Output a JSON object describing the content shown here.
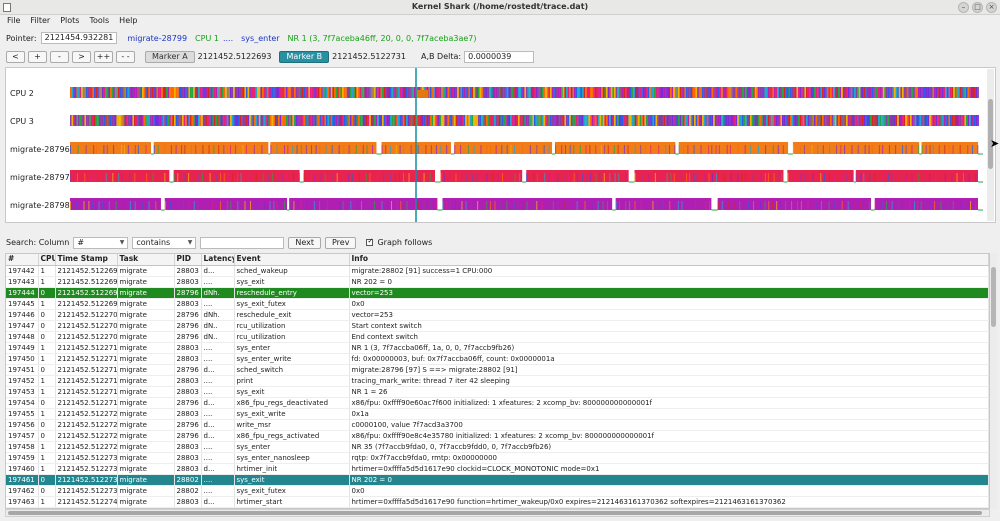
{
  "window": {
    "title": "Kernel Shark (/home/rostedt/trace.dat)"
  },
  "menu": [
    "File",
    "Filter",
    "Plots",
    "Tools",
    "Help"
  ],
  "pointer": {
    "label": "Pointer:",
    "value": "2121454.932281",
    "task": "migrate-28799",
    "cpu": "CPU 1",
    "latency": "....",
    "event": "sys_enter",
    "info": "NR 1 (3, 7f7aceba46ff, 20, 0, 0, 7f7aceba3ae7)"
  },
  "nav": {
    "buttons": [
      "<",
      "+",
      "-",
      ">",
      "++",
      "- -"
    ],
    "marker_a": {
      "label": "Marker A",
      "value": "2121452.5122693"
    },
    "marker_b": {
      "label": "Marker B",
      "value": "2121452.5122731"
    },
    "delta": {
      "label": "A,B Delta:",
      "value": "0.0000039"
    }
  },
  "graph": {
    "rows": [
      "CPU 2",
      "CPU 3",
      "migrate-28796",
      "migrate-28797",
      "migrate-28798"
    ],
    "colors": {
      "marker": "#118fa0",
      "cpu_palette": [
        "#e8207b",
        "#7b2bd9",
        "#2a5ee8",
        "#b61fb6",
        "#ff6a00",
        "#1fa7d0",
        "#d8261f",
        "#8a3fa8",
        "#f0b400",
        "#24a640"
      ],
      "task_orange": "#f07d1a",
      "task_red": "#e8244e",
      "task_magenta": "#b01fb4"
    }
  },
  "search": {
    "label": "Search: Column",
    "column": "#",
    "condition": "contains",
    "text": "",
    "next": "Next",
    "prev": "Prev",
    "graph_follows": "Graph follows"
  },
  "table": {
    "headers": [
      "#",
      "CPU",
      "Time Stamp",
      "Task",
      "PID",
      "Latency",
      "Event",
      "Info"
    ],
    "rows": [
      [
        "197442",
        "1",
        "2121452.512269",
        "migrate",
        "28803",
        "d...",
        "sched_wakeup",
        "migrate:28802 [91] success=1 CPU:000"
      ],
      [
        "197443",
        "1",
        "2121452.512269",
        "migrate",
        "28803",
        "....",
        "sys_exit",
        "NR 202 = 0"
      ],
      [
        "197444",
        "0",
        "2121452.512269",
        "migrate",
        "28796",
        "dNh.",
        "reschedule_entry",
        "vector=253"
      ],
      [
        "197445",
        "1",
        "2121452.512269",
        "migrate",
        "28803",
        "....",
        "sys_exit_futex",
        "0x0"
      ],
      [
        "197446",
        "0",
        "2121452.512270",
        "migrate",
        "28796",
        "dNh.",
        "reschedule_exit",
        "vector=253"
      ],
      [
        "197447",
        "0",
        "2121452.512270",
        "migrate",
        "28796",
        "dN..",
        "rcu_utilization",
        "Start context switch"
      ],
      [
        "197448",
        "0",
        "2121452.512270",
        "migrate",
        "28796",
        "dN..",
        "rcu_utilization",
        "End context switch"
      ],
      [
        "197449",
        "1",
        "2121452.512271",
        "migrate",
        "28803",
        "....",
        "sys_enter",
        "NR 1 (3, 7f7accba06ff, 1a, 0, 0, 7f7accb9fb26)"
      ],
      [
        "197450",
        "1",
        "2121452.512271",
        "migrate",
        "28803",
        "....",
        "sys_enter_write",
        "fd: 0x00000003, buf: 0x7f7accba06ff, count: 0x0000001a"
      ],
      [
        "197451",
        "0",
        "2121452.512271",
        "migrate",
        "28796",
        "d...",
        "sched_switch",
        "migrate:28796 [97] S ==> migrate:28802 [91]"
      ],
      [
        "197452",
        "1",
        "2121452.512271",
        "migrate",
        "28803",
        "....",
        "print",
        "tracing_mark_write: thread 7 iter 42 sleeping"
      ],
      [
        "197453",
        "1",
        "2121452.512271",
        "migrate",
        "28803",
        "....",
        "sys_exit",
        "NR 1 = 26"
      ],
      [
        "197454",
        "0",
        "2121452.512271",
        "migrate",
        "28796",
        "d...",
        "x86_fpu_regs_deactivated",
        "x86/fpu: 0xffff90e60ac7f600 initialized: 1 xfeatures: 2 xcomp_bv: 800000000000001f"
      ],
      [
        "197455",
        "1",
        "2121452.512272",
        "migrate",
        "28803",
        "....",
        "sys_exit_write",
        "0x1a"
      ],
      [
        "197456",
        "0",
        "2121452.512272",
        "migrate",
        "28796",
        "d...",
        "write_msr",
        "c0000100, value 7f7acd3a3700"
      ],
      [
        "197457",
        "0",
        "2121452.512272",
        "migrate",
        "28796",
        "d...",
        "x86_fpu_regs_activated",
        "x86/fpu: 0xffff90e8c4e35780 initialized: 1 xfeatures: 2 xcomp_bv: 800000000000001f"
      ],
      [
        "197458",
        "1",
        "2121452.512272",
        "migrate",
        "28803",
        "....",
        "sys_enter",
        "NR 35 (7f7accb9fda0, 0, 7f7accb9fdd0, 0, 7f7accb9fb26)"
      ],
      [
        "197459",
        "1",
        "2121452.512273",
        "migrate",
        "28803",
        "....",
        "sys_enter_nanosleep",
        "rqtp: 0x7f7accb9fda0, rmtp: 0x00000000"
      ],
      [
        "197460",
        "1",
        "2121452.512273",
        "migrate",
        "28803",
        "d...",
        "hrtimer_init",
        "hrtimer=0xffffa5d5d1617e90 clockid=CLOCK_MONOTONIC mode=0x1"
      ],
      [
        "197461",
        "0",
        "2121452.512273",
        "migrate",
        "28802",
        "....",
        "sys_exit",
        "NR 202 = 0"
      ],
      [
        "197462",
        "0",
        "2121452.512273",
        "migrate",
        "28802",
        "....",
        "sys_exit_futex",
        "0x0"
      ],
      [
        "197463",
        "1",
        "2121452.512274",
        "migrate",
        "28803",
        "d...",
        "hrtimer_start",
        "hrtimer=0xffffa5d5d1617e90 function=hrtimer_wakeup/0x0 expires=2121463161370362 softexpires=2121463161370362"
      ]
    ],
    "highlight_green_row": 2,
    "highlight_teal_row": 19
  }
}
